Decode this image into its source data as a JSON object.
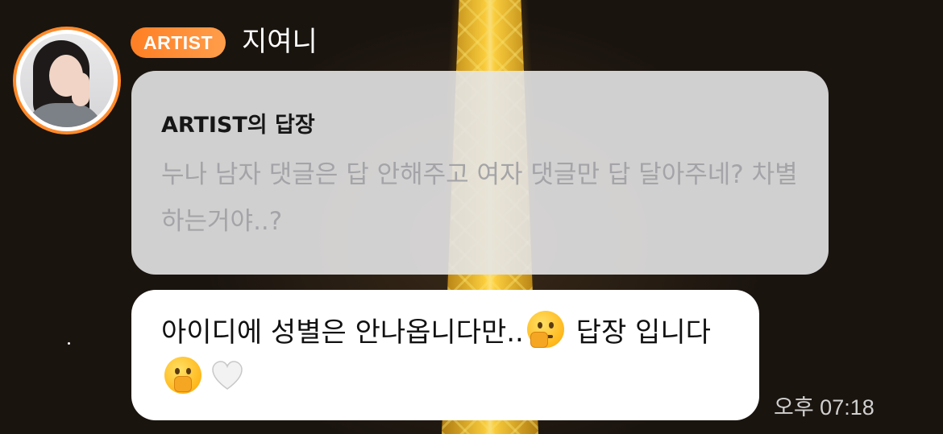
{
  "author": {
    "badge": "ARTIST",
    "name": "지여니"
  },
  "quoted_comment": {
    "title": "ARTIST의 답장",
    "text": "누나 남자 댓글은 답 안해주고 여자 댓글만 답 달아주네? 차별 하는거야..?"
  },
  "reply": {
    "text_part1": "아이디에 성별은 안나옵니다만..",
    "emoji1": "thinking-face-emoji",
    "text_part2": " 답장 입니다",
    "emoji2": "hand-over-mouth-emoji",
    "emoji3": "white-heart-emoji"
  },
  "timestamp": "오후 07:18",
  "colors": {
    "accent": "#ff8a2a",
    "bubble_quote": "#e4e4e6",
    "bubble_reply": "#ffffff"
  }
}
